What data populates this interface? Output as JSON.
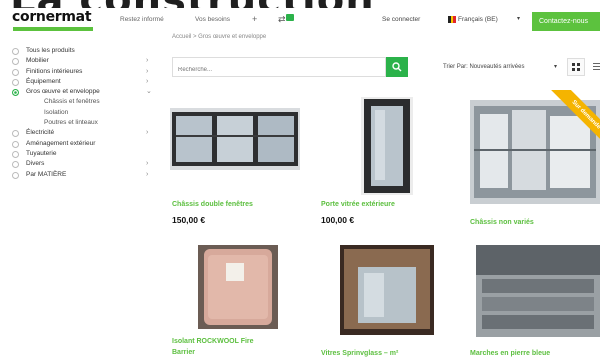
{
  "banner": {
    "text": "La construction"
  },
  "header": {
    "logo": "cornermat",
    "nav": [
      {
        "label": "Restez informé"
      },
      {
        "label": "Vos besoins"
      }
    ],
    "nav_plus": "+",
    "cart_badge": "0",
    "connect": "Se connecter",
    "language": "Français (BE)",
    "contact_button": "Contactez-nous"
  },
  "breadcrumb": "Accueil > Gros œuvre et enveloppe",
  "sidebar": {
    "items": [
      {
        "label": "Tous les produits",
        "level": 0,
        "active": false,
        "chevron": ""
      },
      {
        "label": "Mobilier",
        "level": 0,
        "active": false,
        "chevron": "›"
      },
      {
        "label": "Finitions intérieures",
        "level": 0,
        "active": false,
        "chevron": "›"
      },
      {
        "label": "Équipement",
        "level": 0,
        "active": false,
        "chevron": "›"
      },
      {
        "label": "Gros œuvre et enveloppe",
        "level": 0,
        "active": true,
        "chevron": "⌄"
      },
      {
        "label": "Châssis et fenêtres",
        "level": 1,
        "active": false,
        "chevron": ""
      },
      {
        "label": "Isolation",
        "level": 1,
        "active": false,
        "chevron": ""
      },
      {
        "label": "Poutres et linteaux",
        "level": 1,
        "active": false,
        "chevron": ""
      },
      {
        "label": "Électricité",
        "level": 0,
        "active": false,
        "chevron": "›"
      },
      {
        "label": "Aménagement extérieur",
        "level": 0,
        "active": false,
        "chevron": ""
      },
      {
        "label": "Tuyauterie",
        "level": 0,
        "active": false,
        "chevron": ""
      },
      {
        "label": "Divers",
        "level": 0,
        "active": false,
        "chevron": "›"
      },
      {
        "label": "Par MATIÈRE",
        "level": 0,
        "active": false,
        "chevron": "›"
      }
    ]
  },
  "search": {
    "placeholder": "Recherche..."
  },
  "sort": {
    "label": "Trier Par: Nouveautés arrivées",
    "caret": "▾"
  },
  "ribbon": {
    "text": "Sur demande"
  },
  "products": [
    {
      "title": "Châssis double fenêtres",
      "price": "150,00 €"
    },
    {
      "title": "Porte vitrée extérieure",
      "price": "100,00 €"
    },
    {
      "title": "Châssis non variés",
      "price": ""
    },
    {
      "title": "Isolant ROCKWOOL Fire",
      "title2": "Barrier",
      "price": ""
    },
    {
      "title": "Vitres Sprinvglass – m²",
      "price": ""
    },
    {
      "title": "Marches en pierre bleue",
      "price": ""
    }
  ],
  "colors": {
    "accent": "#5cc23e",
    "accent_dark": "#2bb24a",
    "ribbon": "#f5b400"
  }
}
